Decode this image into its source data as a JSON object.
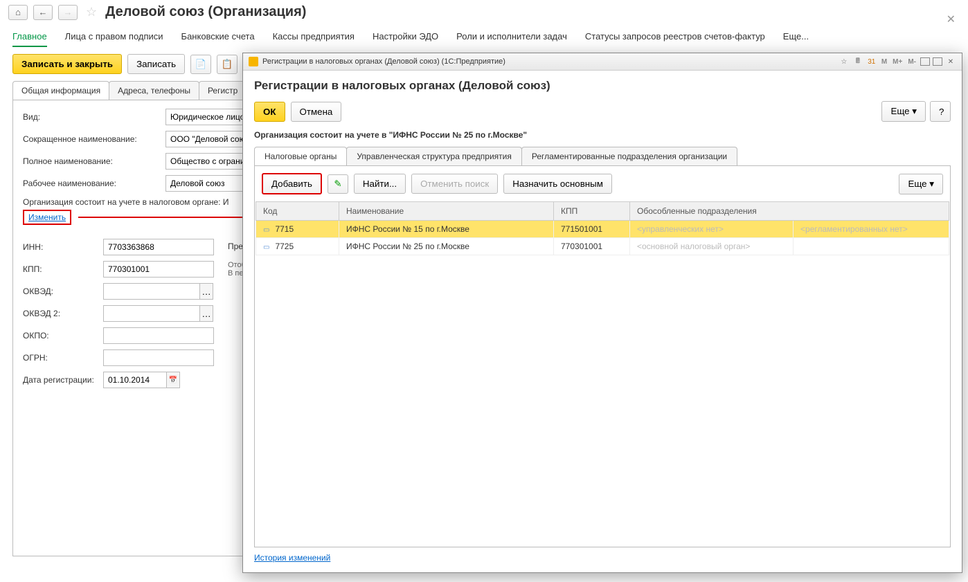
{
  "page_title": "Деловой союз (Организация)",
  "main_tabs": [
    "Главное",
    "Лица с правом подписи",
    "Банковские счета",
    "Кассы предприятия",
    "Настройки ЭДО",
    "Роли и исполнители задач",
    "Статусы запросов реестров счетов-фактур",
    "Еще..."
  ],
  "toolbar": {
    "save_close": "Записать и закрыть",
    "save": "Записать"
  },
  "inner_tabs": [
    "Общая информация",
    "Адреса, телефоны",
    "Регистр"
  ],
  "form": {
    "kind_label": "Вид:",
    "kind_value": "Юридическое лицо",
    "short_label": "Сокращенное наименование:",
    "short_value": "ООО \"Деловой союз\"",
    "full_label": "Полное наименование:",
    "full_value": "Общество с ограничен",
    "work_label": "Рабочее наименование:",
    "work_value": "Деловой союз",
    "reg_text": "Организация состоит на учете в налоговом органе: И",
    "change_link": "Изменить",
    "inn_label": "ИНН:",
    "inn_value": "7703363868",
    "kpp_label": "КПП:",
    "kpp_value": "770301001",
    "okved_label": "ОКВЭД:",
    "okved2_label": "ОКВЭД 2:",
    "okpo_label": "ОКПО:",
    "ogrn_label": "ОГРН:",
    "date_label": "Дата регистрации:",
    "date_value": "01.10.2014",
    "prefix_label": "Префи",
    "note1": "Отобра",
    "note2": "В печа"
  },
  "dialog": {
    "wintitle": "Регистрации в налоговых органах (Деловой союз)  (1С:Предприятие)",
    "title": "Регистрации в налоговых органах (Деловой союз)",
    "ok": "ОК",
    "cancel": "Отмена",
    "more": "Еще",
    "help": "?",
    "info_text": "Организация состоит на учете в \"ИФНС России № 25 по г.Москве\"",
    "tabs": [
      "Налоговые органы",
      "Управленческая структура предприятия",
      "Регламентированные подразделения организации"
    ],
    "tb": {
      "add": "Добавить",
      "find": "Найти...",
      "cancel_find": "Отменить поиск",
      "set_main": "Назначить основным",
      "more": "Еще"
    },
    "cols": {
      "code": "Код",
      "name": "Наименование",
      "kpp": "КПП",
      "sep": "Обособленные подразделения"
    },
    "rows": [
      {
        "code": "7715",
        "name": "ИФНС России № 15 по г.Москве",
        "kpp": "771501001",
        "sep1": "<управленческих нет>",
        "sep2": "<регламентированных нет>",
        "selected": true
      },
      {
        "code": "7725",
        "name": "ИФНС России № 25 по г.Москве",
        "kpp": "770301001",
        "sep1": "<основной налоговый орган>",
        "sep2": "",
        "selected": false
      }
    ],
    "history": "История изменений"
  }
}
